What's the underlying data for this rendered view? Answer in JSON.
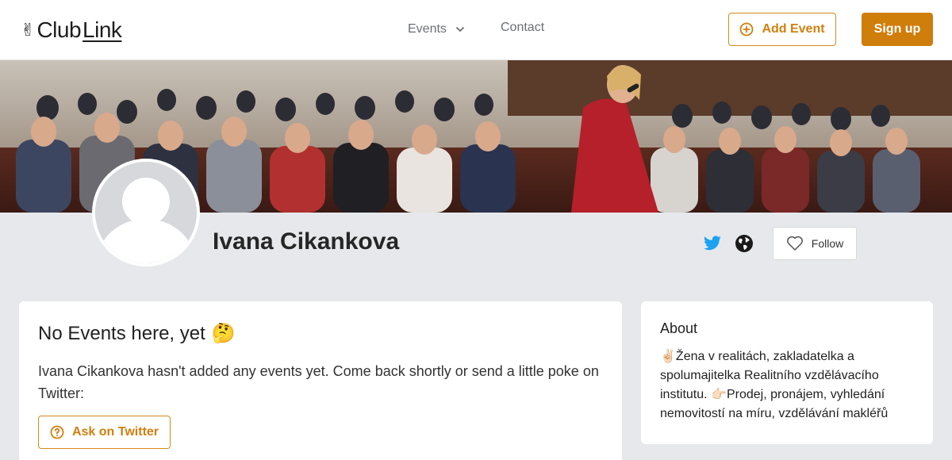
{
  "header": {
    "logo_emoji": "✌",
    "logo_part1": "Club",
    "logo_part2": "Link",
    "nav": {
      "events_label": "Events",
      "contact_label": "Contact"
    },
    "add_event_label": "Add Event",
    "sign_up_label": "Sign up"
  },
  "profile": {
    "name": "Ivana Cikankova",
    "follow_label": "Follow",
    "social_icons": [
      "twitter-icon",
      "globe-icon"
    ]
  },
  "events_card": {
    "title": "No Events here, yet",
    "title_emoji": "🤔",
    "message": "Ivana Cikankova hasn't added any events yet. Come back shortly or send a little poke on Twitter:",
    "ask_button_label": "Ask on Twitter"
  },
  "about_card": {
    "title": "About",
    "text": "✌🏻Žena v realitách, zakladatelka a spolumajitelka Realitního vzdělávacího institutu. 👉🏻Prodej, pronájem, vyhledání nemovitostí na míru, vzdělávání makléřů"
  },
  "colors": {
    "accent": "#cf7d0b",
    "twitter": "#1da1f2",
    "page_bg": "#e7e8ec"
  }
}
